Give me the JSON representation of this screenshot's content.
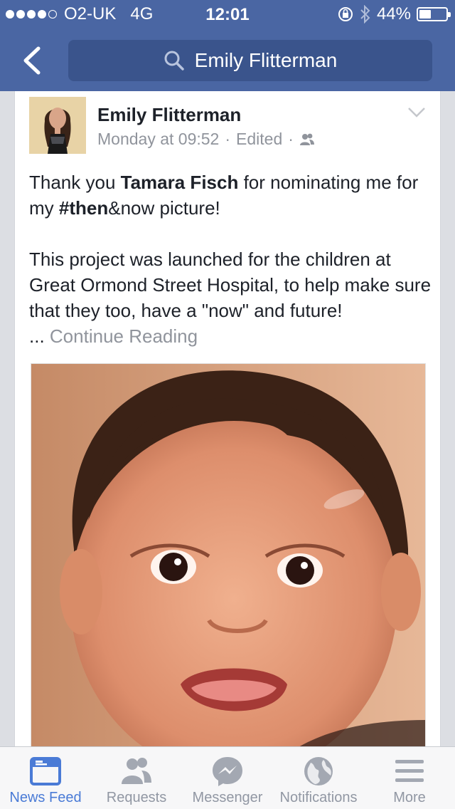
{
  "status": {
    "carrier": "O2-UK",
    "network": "4G",
    "time": "12:01",
    "battery": "44%",
    "battery_level": 0.44,
    "signal_bars": 4
  },
  "nav": {
    "search_text": "Emily Flitterman"
  },
  "post": {
    "author": "Emily Flitterman",
    "timestamp": "Monday at 09:52",
    "edited": "Edited",
    "separator": "·",
    "text_p1_a": "Thank you ",
    "text_p1_mention": "Tamara Fisch",
    "text_p1_b": " for nominating me for my ",
    "text_p1_hash": "#then",
    "text_p1_c": "&now picture!",
    "text_p2": "This project was launched for the children at Great Ormond Street Hospital, to help make sure that they too, have a \"now\" and future!",
    "ellipsis": "... ",
    "continue_reading": "Continue Reading"
  },
  "tabs": [
    {
      "label": "News Feed",
      "icon": "news-feed-icon",
      "active": true
    },
    {
      "label": "Requests",
      "icon": "friend-requests-icon"
    },
    {
      "label": "Messenger",
      "icon": "messenger-icon"
    },
    {
      "label": "Notifications",
      "icon": "globe-icon"
    },
    {
      "label": "More",
      "icon": "hamburger-icon"
    }
  ],
  "colors": {
    "brand": "#4a66a3",
    "active_tab": "#4a7bd6",
    "muted": "#90949c"
  }
}
